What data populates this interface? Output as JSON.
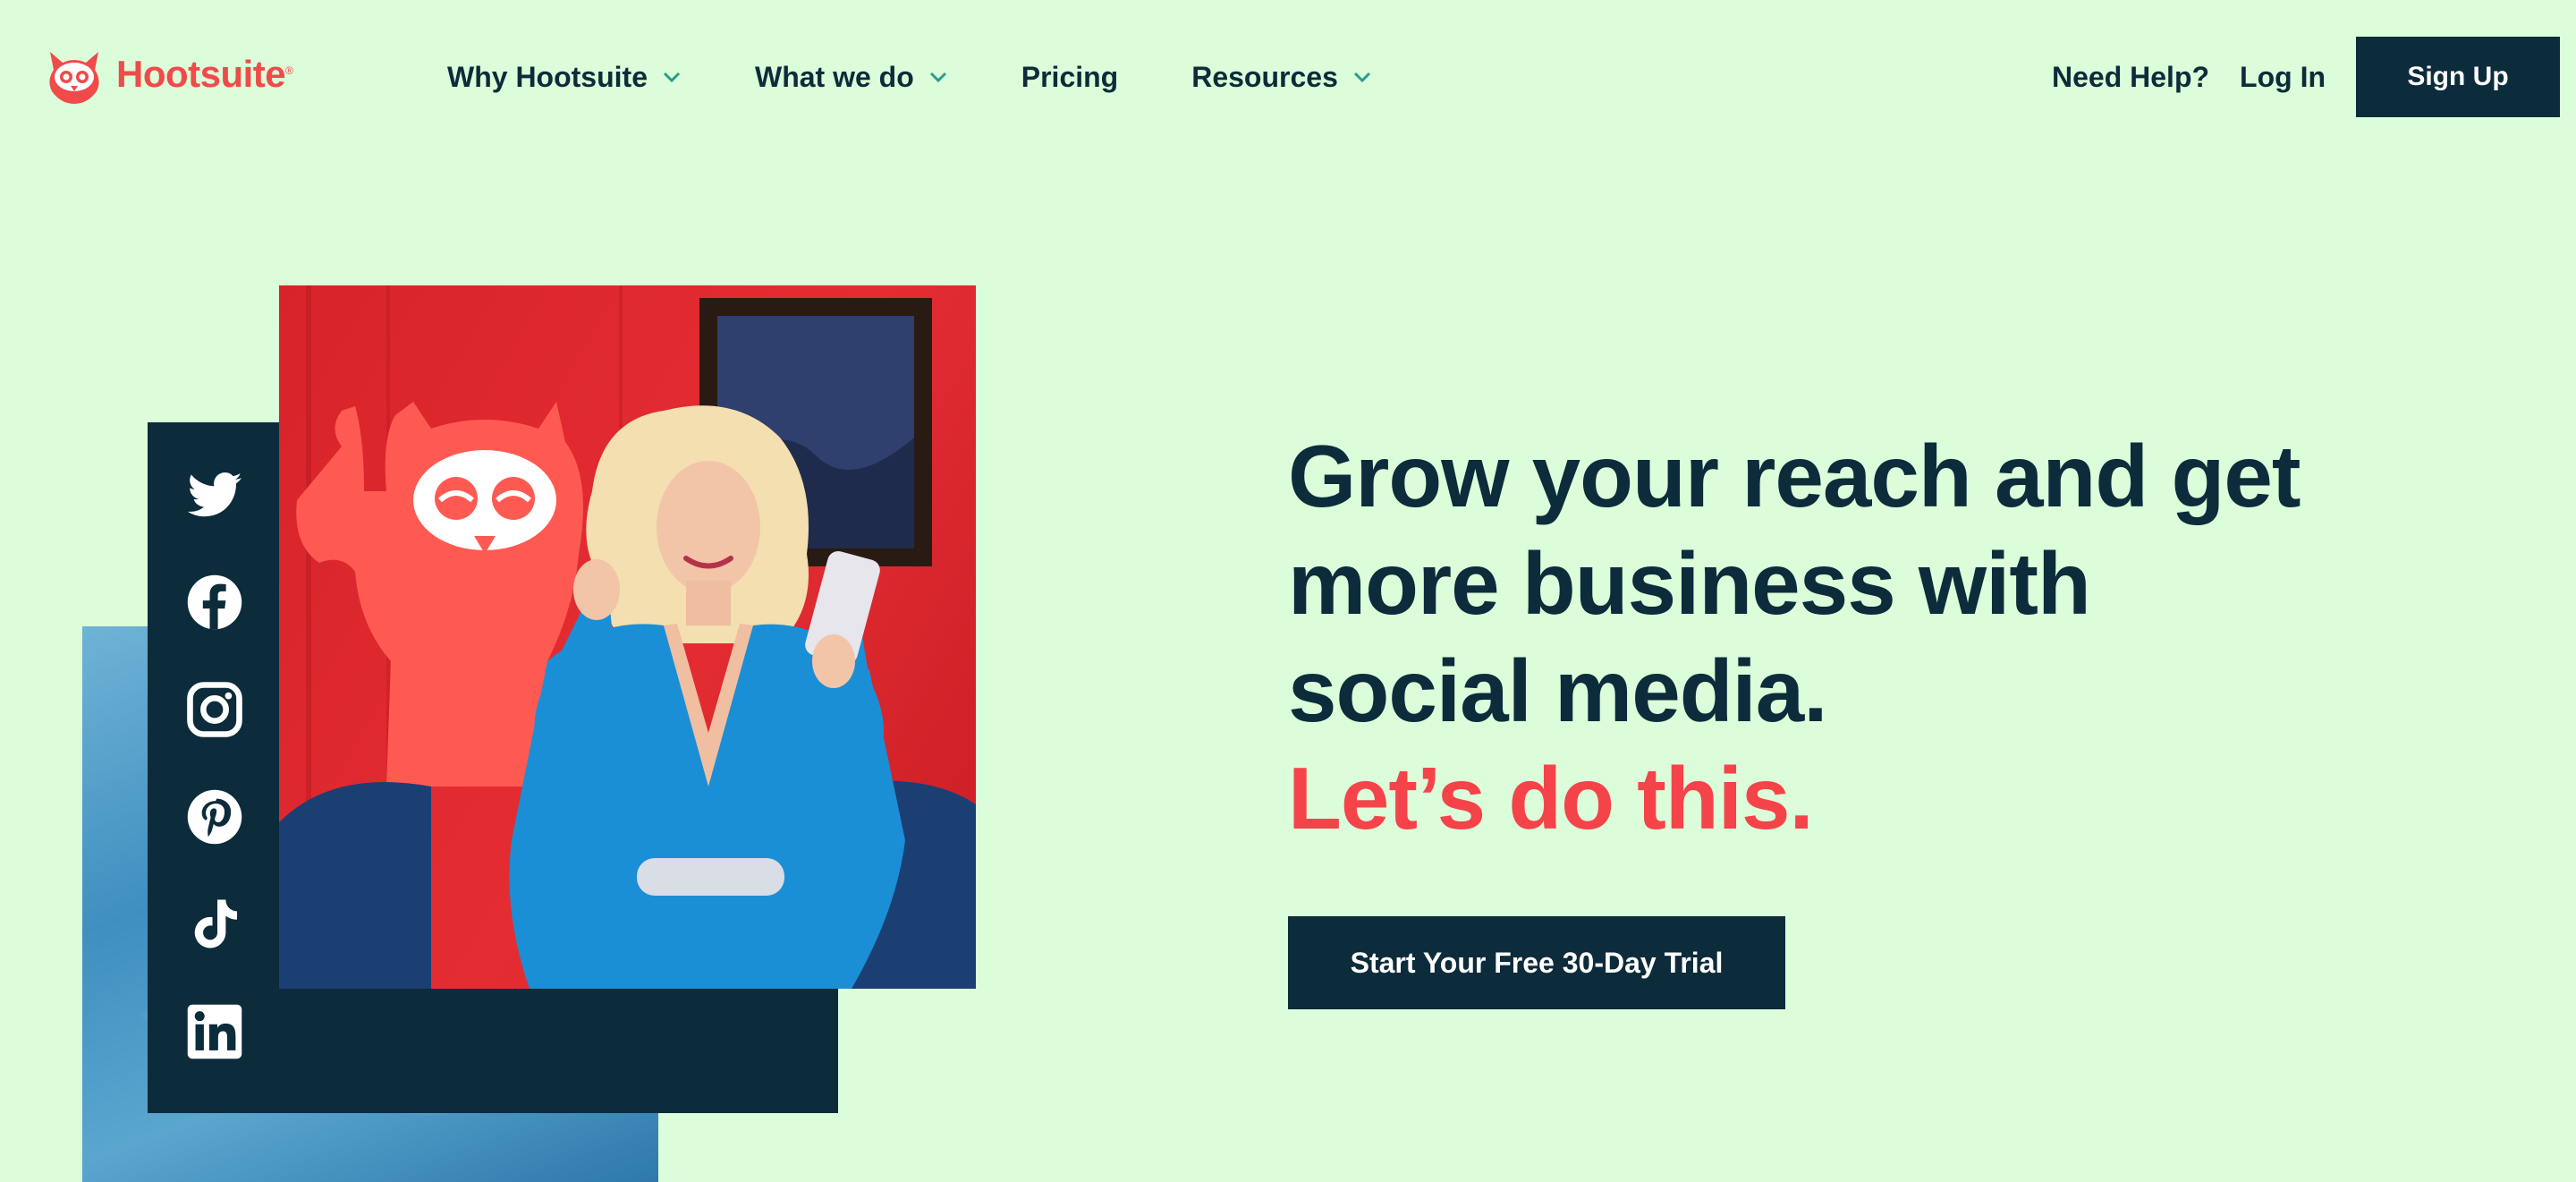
{
  "brand": {
    "name": "Hootsuite",
    "trademark": "®",
    "color": "#f04a4a"
  },
  "nav": {
    "items": [
      {
        "label": "Why Hootsuite",
        "has_dropdown": true
      },
      {
        "label": "What we do",
        "has_dropdown": true
      },
      {
        "label": "Pricing",
        "has_dropdown": false
      },
      {
        "label": "Resources",
        "has_dropdown": true
      }
    ]
  },
  "header_right": {
    "help_label": "Need Help?",
    "login_label": "Log In",
    "signup_label": "Sign Up"
  },
  "hero": {
    "headline_lines": [
      "Grow your reach and get",
      "more business with",
      "social media."
    ],
    "accent_line": "Let’s do this.",
    "cta_label": "Start Your Free 30-Day Trial"
  },
  "social_icons": [
    "twitter-icon",
    "facebook-icon",
    "instagram-icon",
    "pinterest-icon",
    "tiktok-icon",
    "linkedin-icon"
  ],
  "colors": {
    "background": "#dcfdd9",
    "navy": "#0c2b3b",
    "accent": "#f5434a"
  }
}
